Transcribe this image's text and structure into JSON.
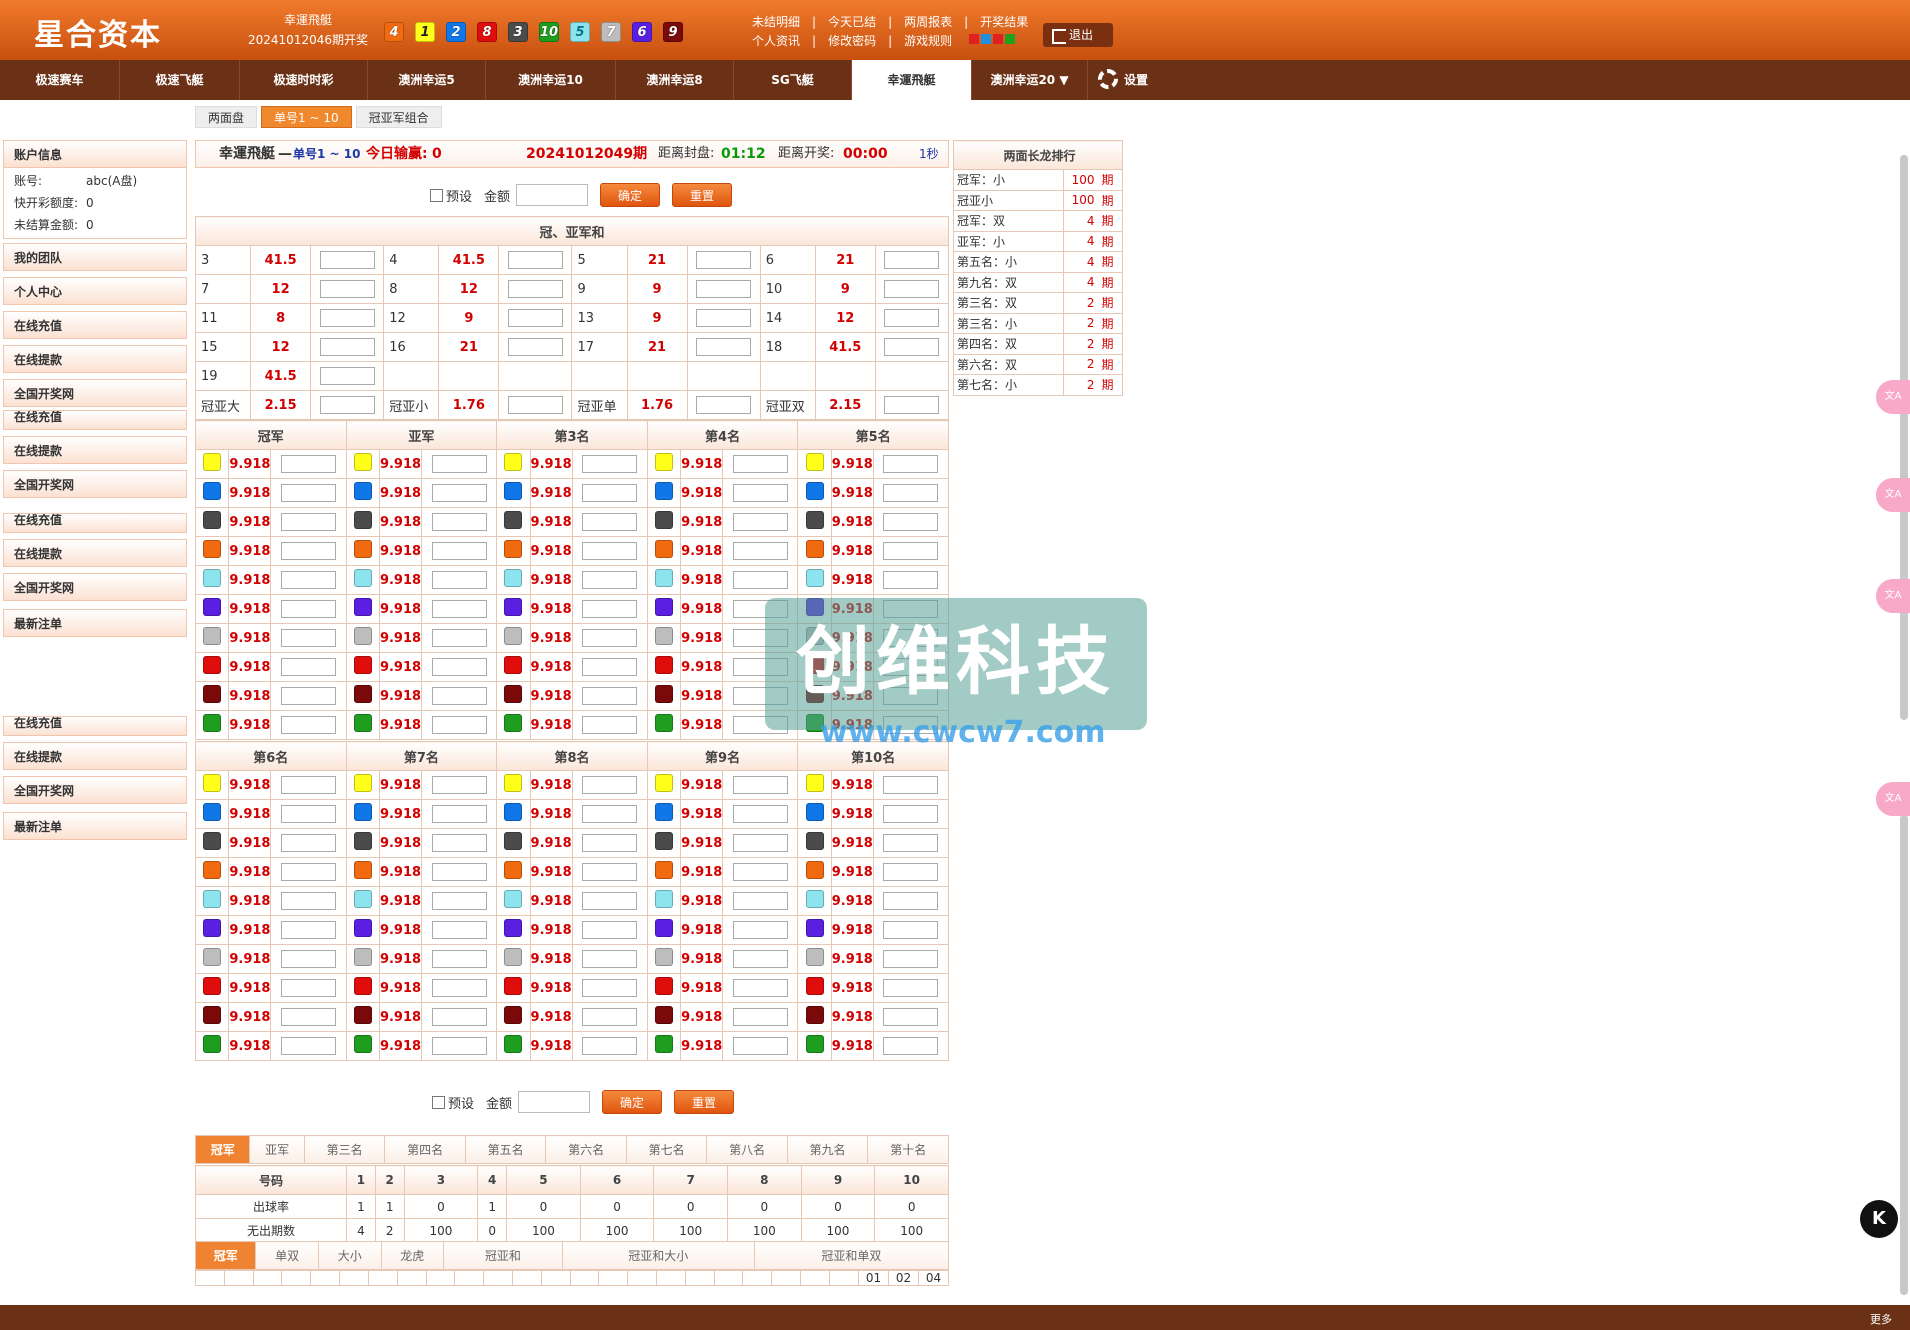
{
  "header": {
    "logo": "星合资本",
    "lottery_name": "幸運飛艇",
    "prev_issue": "20241012046期开奖",
    "draw_numbers": [
      4,
      1,
      2,
      8,
      3,
      10,
      5,
      7,
      6,
      9
    ],
    "links_row1": [
      "未结明细",
      "今天已结",
      "两周报表",
      "开奖结果"
    ],
    "links_row2": [
      "个人资讯",
      "修改密码",
      "游戏规则"
    ],
    "logout_label": "退出"
  },
  "nav": {
    "items": [
      "极速赛车",
      "极速飞艇",
      "极速时时彩",
      "澳洲幸运5",
      "澳洲幸运10",
      "澳洲幸运8",
      "SG飞艇",
      "幸運飛艇",
      "澳洲幸运20 ▼"
    ],
    "active": "幸運飛艇",
    "settings_label": "设置"
  },
  "subtabs": {
    "items": [
      "两面盘",
      "单号1 ~ 10",
      "冠亚军组合"
    ],
    "active": "单号1 ~ 10"
  },
  "sidebar": {
    "account_title": "账户信息",
    "account_rows": [
      {
        "k": "账号:",
        "v": "abc(A盘)"
      },
      {
        "k": "快开彩额度:",
        "v": "0"
      },
      {
        "k": "未结算金额:",
        "v": "0"
      }
    ],
    "menu": [
      "我的团队",
      "个人中心",
      "在线充值",
      "在线提款",
      "全国开奖网"
    ],
    "dup1": [
      "在线充值",
      "在线提款",
      "全国开奖网"
    ],
    "dup2": [
      "在线充值",
      "在线提款",
      "全国开奖网",
      "最新注单"
    ],
    "dup3": [
      "在线充值",
      "在线提款",
      "全国开奖网",
      "最新注单"
    ]
  },
  "panel": {
    "game": "幸運飛艇",
    "dash": "—",
    "mode": "单号1 ~ 10",
    "pl_label": "今日输赢:",
    "pl_value": "0",
    "issue": "20241012049期",
    "close_label": "距离封盘:",
    "close_time": "01:12",
    "open_label": "距离开奖:",
    "open_time": "00:00",
    "refresh": "1秒"
  },
  "form": {
    "preset_label": "预设",
    "amount_label": "金额",
    "confirm": "确定",
    "reset": "重置"
  },
  "sum": {
    "title": "冠、亚军和",
    "rows": [
      [
        {
          "n": "3",
          "o": "41.5"
        },
        {
          "n": "4",
          "o": "41.5"
        },
        {
          "n": "5",
          "o": "21"
        },
        {
          "n": "6",
          "o": "21"
        }
      ],
      [
        {
          "n": "7",
          "o": "12"
        },
        {
          "n": "8",
          "o": "12"
        },
        {
          "n": "9",
          "o": "9"
        },
        {
          "n": "10",
          "o": "9"
        }
      ],
      [
        {
          "n": "11",
          "o": "8"
        },
        {
          "n": "12",
          "o": "9"
        },
        {
          "n": "13",
          "o": "9"
        },
        {
          "n": "14",
          "o": "12"
        }
      ],
      [
        {
          "n": "15",
          "o": "12"
        },
        {
          "n": "16",
          "o": "21"
        },
        {
          "n": "17",
          "o": "21"
        },
        {
          "n": "18",
          "o": "41.5"
        }
      ],
      [
        {
          "n": "19",
          "o": "41.5"
        }
      ],
      [
        {
          "n": "冠亚大",
          "o": "2.15"
        },
        {
          "n": "冠亚小",
          "o": "1.76"
        },
        {
          "n": "冠亚单",
          "o": "1.76"
        },
        {
          "n": "冠亚双",
          "o": "2.15"
        }
      ]
    ]
  },
  "positions1": [
    "冠军",
    "亚军",
    "第3名",
    "第4名",
    "第5名"
  ],
  "positions2": [
    "第6名",
    "第7名",
    "第8名",
    "第9名",
    "第10名"
  ],
  "number_odds": "9.918",
  "rank": {
    "title": "两面长龙排行",
    "rows": [
      {
        "k": "冠军：小",
        "v": "100",
        "u": "期"
      },
      {
        "k": "冠亚小",
        "v": "100",
        "u": "期"
      },
      {
        "k": "冠军：双",
        "v": "4",
        "u": "期"
      },
      {
        "k": "亚军：小",
        "v": "4",
        "u": "期"
      },
      {
        "k": "第五名：小",
        "v": "4",
        "u": "期"
      },
      {
        "k": "第九名：双",
        "v": "4",
        "u": "期"
      },
      {
        "k": "第三名：双",
        "v": "2",
        "u": "期"
      },
      {
        "k": "第三名：小",
        "v": "2",
        "u": "期"
      },
      {
        "k": "第四名：双",
        "v": "2",
        "u": "期"
      },
      {
        "k": "第六名：双",
        "v": "2",
        "u": "期"
      },
      {
        "k": "第七名：小",
        "v": "2",
        "u": "期"
      }
    ]
  },
  "stats": {
    "tabs": [
      "冠军",
      "亚军",
      "第三名",
      "第四名",
      "第五名",
      "第六名",
      "第七名",
      "第八名",
      "第九名",
      "第十名"
    ],
    "head": [
      "号码",
      "1",
      "2",
      "3",
      "4",
      "5",
      "6",
      "7",
      "8",
      "9",
      "10"
    ],
    "row1": [
      "出球率",
      "1",
      "1",
      "0",
      "1",
      "0",
      "0",
      "0",
      "0",
      "0",
      "0"
    ],
    "row2": [
      "无出期数",
      "4",
      "2",
      "100",
      "0",
      "100",
      "100",
      "100",
      "100",
      "100",
      "100"
    ]
  },
  "stats2": {
    "tabs": [
      "冠军",
      "单双",
      "大小",
      "龙虎",
      "冠亚和",
      "冠亚和大小",
      "冠亚和单双"
    ],
    "last": [
      "01",
      "02",
      "04"
    ]
  },
  "watermark": {
    "text": "创维科技",
    "url": "www.cwcw7.com"
  },
  "footer": {
    "more": "更多"
  },
  "misc": {
    "translate_icon": "文A",
    "hk_badge": "K"
  }
}
